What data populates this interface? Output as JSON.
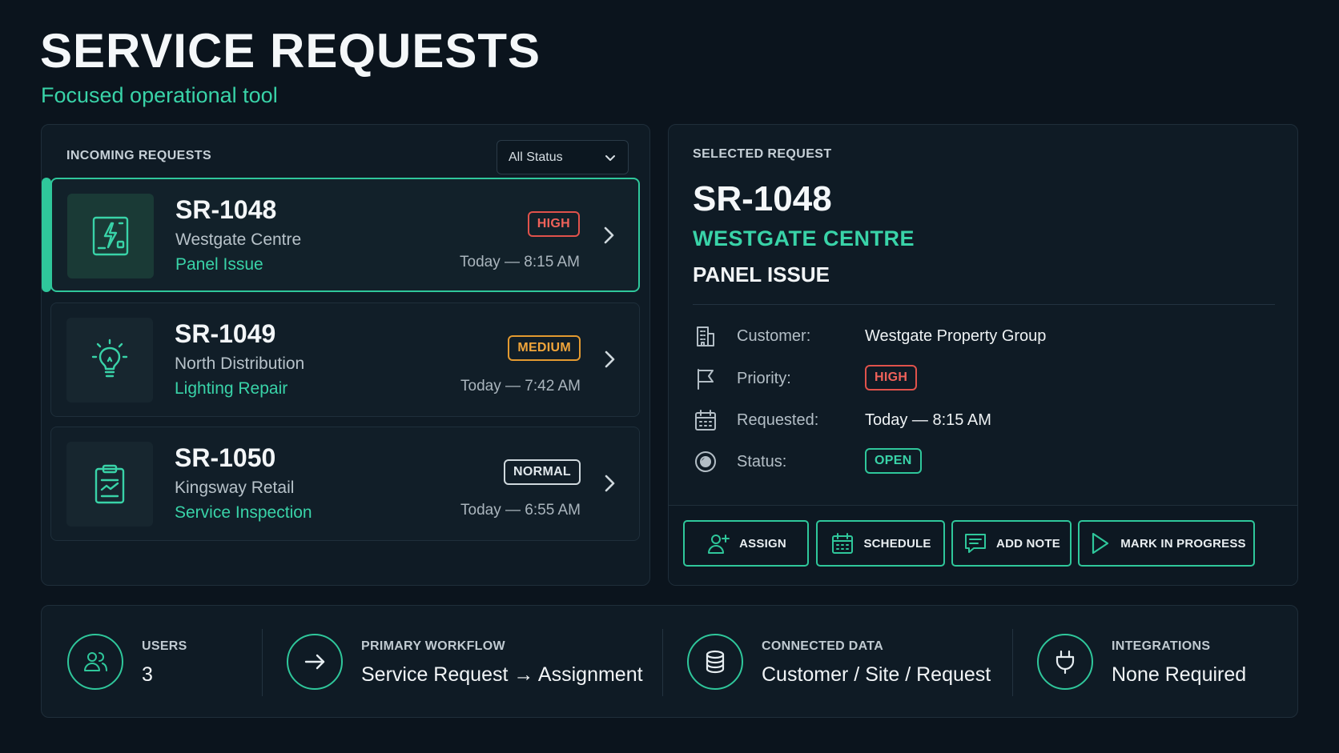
{
  "header": {
    "title": "SERVICE REQUESTS",
    "subtitle": "Focused operational tool"
  },
  "incoming": {
    "label": "INCOMING REQUESTS",
    "filter": {
      "selected": "All Status"
    },
    "requests": [
      {
        "id": "SR-1048",
        "site": "Westgate Centre",
        "type": "Panel Issue",
        "priority": "HIGH",
        "time": "Today — 8:15 AM",
        "icon": "electrical-panel-icon",
        "selected": true
      },
      {
        "id": "SR-1049",
        "site": "North Distribution",
        "type": "Lighting Repair",
        "priority": "MEDIUM",
        "time": "Today — 7:42 AM",
        "icon": "lightbulb-icon",
        "selected": false
      },
      {
        "id": "SR-1050",
        "site": "Kingsway Retail",
        "type": "Service Inspection",
        "priority": "NORMAL",
        "time": "Today — 6:55 AM",
        "icon": "clipboard-icon",
        "selected": false
      }
    ]
  },
  "selected": {
    "label": "SELECTED REQUEST",
    "id": "SR-1048",
    "site": "WESTGATE CENTRE",
    "type": "PANEL ISSUE",
    "details": {
      "customer_label": "Customer:",
      "customer_value": "Westgate Property Group",
      "priority_label": "Priority:",
      "priority_value": "HIGH",
      "requested_label": "Requested:",
      "requested_value": "Today — 8:15 AM",
      "status_label": "Status:",
      "status_value": "OPEN"
    },
    "actions": {
      "assign": "ASSIGN",
      "schedule": "SCHEDULE",
      "add_note": "ADD NOTE",
      "mark_in_progress": "MARK IN PROGRESS"
    }
  },
  "stats": {
    "users_label": "USERS",
    "users_value": "3",
    "workflow_label": "PRIMARY WORKFLOW",
    "workflow_value": "Service Request → Assignment",
    "data_label": "CONNECTED DATA",
    "data_value": "Customer / Site / Request",
    "integrations_label": "INTEGRATIONS",
    "integrations_value": "None Required"
  },
  "colors": {
    "accent": "#2fc79b",
    "background": "#0b141d",
    "panel": "#0f1b25",
    "high": "#e0524b",
    "medium": "#e39a30"
  }
}
